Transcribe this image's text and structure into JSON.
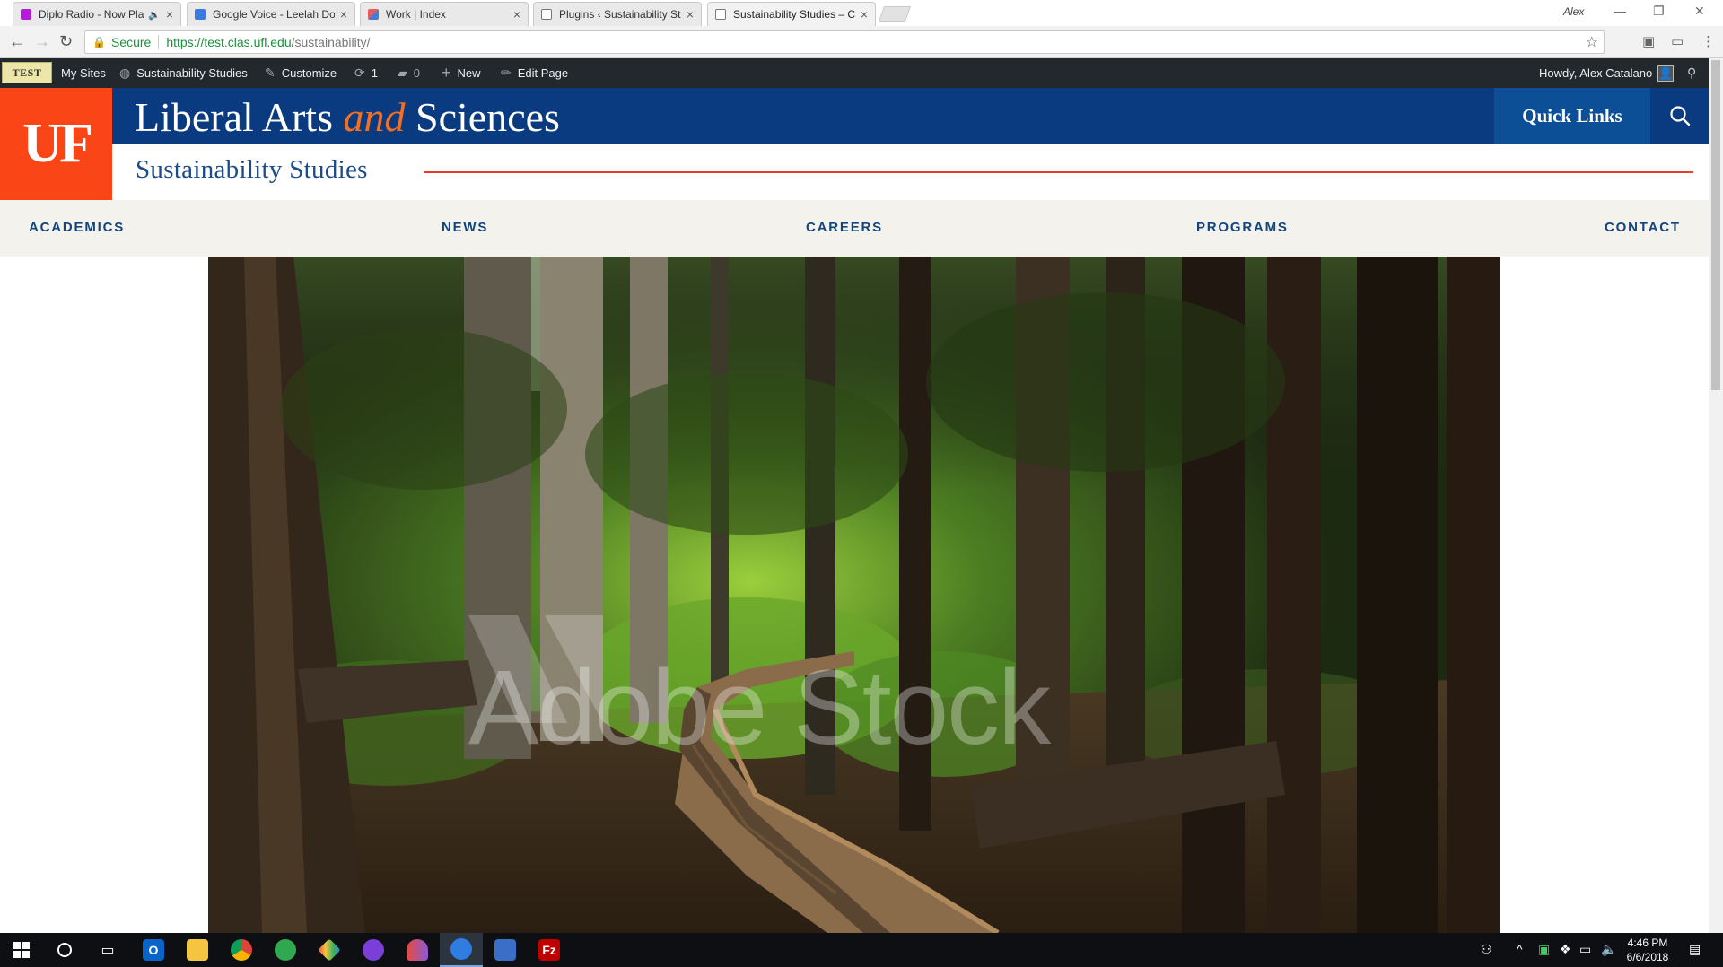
{
  "browser": {
    "tabs": [
      {
        "title": "Diplo Radio - Now Pla",
        "favicon_color": "#b31dd6",
        "audio": true,
        "active": false
      },
      {
        "title": "Google Voice - Leelah Do",
        "favicon_color": "#3b7be0",
        "active": false
      },
      {
        "title": "Work | Index",
        "favicon_color": "#e65d5d",
        "active": false
      },
      {
        "title": "Plugins ‹ Sustainability St",
        "favicon_color": "#ffffff",
        "active": false
      },
      {
        "title": "Sustainability Studies – C",
        "favicon_color": "#ffffff",
        "active": true
      }
    ],
    "profile_name": "Alex",
    "secure_label": "Secure",
    "url_scheme_host": "https://test.clas.ufl.edu",
    "url_path": "/sustainability/"
  },
  "adminbar": {
    "badge": "TEST",
    "my_sites": "My Sites",
    "site": "Sustainability Studies",
    "customize": "Customize",
    "updates_count": "1",
    "comments_count": "0",
    "new": "New",
    "edit_page": "Edit Page",
    "howdy": "Howdy, Alex Catalano"
  },
  "header": {
    "logo": "UF",
    "title_part1": "Liberal Arts",
    "title_and": "and",
    "title_part2": "Sciences",
    "quick_links": "Quick Links",
    "site_name": "Sustainability Studies",
    "brand_color": "#0a3a80",
    "accent_color": "#fa4616"
  },
  "nav": {
    "items": [
      "ACADEMICS",
      "NEWS",
      "CAREERS",
      "PROGRAMS",
      "CONTACT"
    ]
  },
  "hero": {
    "watermark": "Adobe Stock",
    "subject": "forest-boardwalk-image"
  },
  "taskbar": {
    "time": "4:46 PM",
    "date": "6/6/2018"
  }
}
